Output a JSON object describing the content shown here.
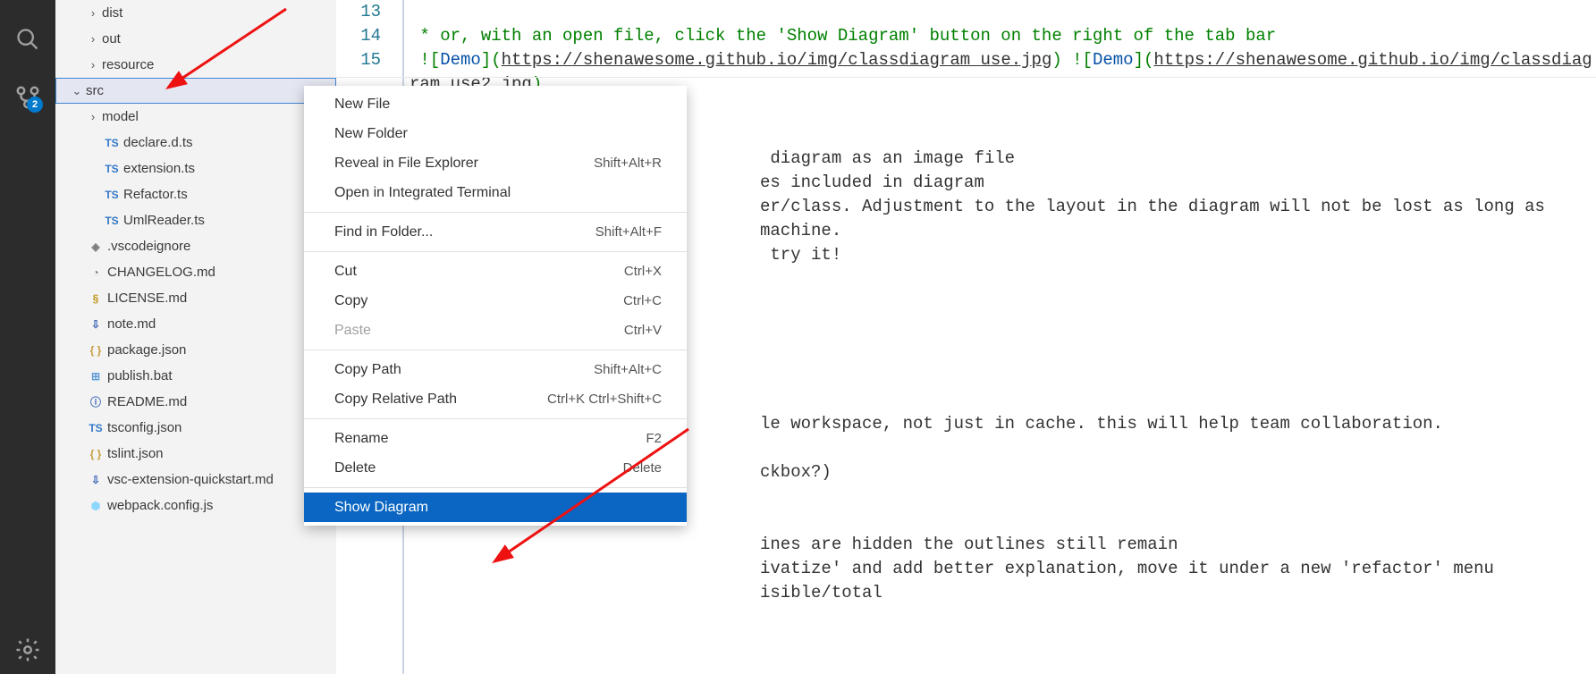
{
  "activity": {
    "search": "search-icon",
    "scm": "source-control-icon",
    "scm_badge": "2",
    "gear": "settings-gear-icon"
  },
  "sidebar": {
    "items": [
      {
        "kind": "folder",
        "open": false,
        "indent": 1,
        "label": "dist"
      },
      {
        "kind": "folder",
        "open": false,
        "indent": 1,
        "label": "out"
      },
      {
        "kind": "folder",
        "open": false,
        "indent": 1,
        "label": "resource"
      },
      {
        "kind": "folder",
        "open": true,
        "indent": 0,
        "label": "src",
        "selected": true
      },
      {
        "kind": "folder",
        "open": false,
        "indent": 1,
        "label": "model"
      },
      {
        "kind": "file",
        "icon": "TS",
        "iconColor": "#3178c6",
        "indent": 2,
        "label": "declare.d.ts"
      },
      {
        "kind": "file",
        "icon": "TS",
        "iconColor": "#3178c6",
        "indent": 2,
        "label": "extension.ts"
      },
      {
        "kind": "file",
        "icon": "TS",
        "iconColor": "#3178c6",
        "indent": 2,
        "label": "Refactor.ts"
      },
      {
        "kind": "file",
        "icon": "TS",
        "iconColor": "#3178c6",
        "indent": 2,
        "label": "UmlReader.ts"
      },
      {
        "kind": "file",
        "icon": "◈",
        "iconColor": "#7a7a7a",
        "indent": 1,
        "label": ".vscodeignore"
      },
      {
        "kind": "file",
        "icon": "◔",
        "iconColor": "#7a7a7a",
        "indent": 1,
        "label": "CHANGELOG.md"
      },
      {
        "kind": "file",
        "icon": "§",
        "iconColor": "#c09820",
        "indent": 1,
        "label": "LICENSE.md"
      },
      {
        "kind": "file",
        "icon": "⇩",
        "iconColor": "#3a66b5",
        "indent": 1,
        "label": "note.md"
      },
      {
        "kind": "file",
        "icon": "{ }",
        "iconColor": "#c79d3c",
        "indent": 1,
        "label": "package.json"
      },
      {
        "kind": "file",
        "icon": "⊞",
        "iconColor": "#5b9bd5",
        "indent": 1,
        "label": "publish.bat"
      },
      {
        "kind": "file",
        "icon": "ⓘ",
        "iconColor": "#3a66b5",
        "indent": 1,
        "label": "README.md"
      },
      {
        "kind": "file",
        "icon": "TS",
        "iconColor": "#3178c6",
        "indent": 1,
        "label": "tsconfig.json"
      },
      {
        "kind": "file",
        "icon": "{ }",
        "iconColor": "#c79d3c",
        "indent": 1,
        "label": "tslint.json"
      },
      {
        "kind": "file",
        "icon": "⇩",
        "iconColor": "#3a66b5",
        "indent": 1,
        "label": "vsc-extension-quickstart.md"
      },
      {
        "kind": "file",
        "icon": "⬢",
        "iconColor": "#8ed6fb",
        "indent": 1,
        "label": "webpack.config.js"
      }
    ]
  },
  "editor": {
    "line_numbers": [
      "13",
      "14",
      "15"
    ],
    "line14_prefix": " * or, with an open file, click the 'Show Diagram' button on the right of the tab bar",
    "line15_a": " ![",
    "line15_demo1": "Demo",
    "line15_b": "](",
    "line15_url1": "https://shenawesome.github.io/img/classdiagram_use.jpg",
    "line15_c": ") ![",
    "line15_demo2": "Demo",
    "line15_d": "](",
    "line15_url2": "https://shenawesome.github.io/img/classdiagram_use2.jpg",
    "line15_e": ")",
    "body_lines": [
      " diagram as an image file",
      "es included in diagram",
      "er/class. Adjustment to the layout in the diagram will not be lost as long as",
      "machine.",
      " try it!",
      "",
      "",
      "",
      "",
      "",
      "",
      "le workspace, not just in cache. this will help team collaboration.",
      "",
      "ckbox?)",
      "",
      "",
      "ines are hidden the outlines still remain",
      "ivatize' and add better explanation, move it under a new 'refactor' menu",
      "isible/total"
    ]
  },
  "context_menu": {
    "groups": [
      [
        {
          "label": "New File",
          "shortcut": ""
        },
        {
          "label": "New Folder",
          "shortcut": ""
        },
        {
          "label": "Reveal in File Explorer",
          "shortcut": "Shift+Alt+R"
        },
        {
          "label": "Open in Integrated Terminal",
          "shortcut": ""
        }
      ],
      [
        {
          "label": "Find in Folder...",
          "shortcut": "Shift+Alt+F"
        }
      ],
      [
        {
          "label": "Cut",
          "shortcut": "Ctrl+X"
        },
        {
          "label": "Copy",
          "shortcut": "Ctrl+C"
        },
        {
          "label": "Paste",
          "shortcut": "Ctrl+V",
          "disabled": true
        }
      ],
      [
        {
          "label": "Copy Path",
          "shortcut": "Shift+Alt+C"
        },
        {
          "label": "Copy Relative Path",
          "shortcut": "Ctrl+K Ctrl+Shift+C"
        }
      ],
      [
        {
          "label": "Rename",
          "shortcut": "F2"
        },
        {
          "label": "Delete",
          "shortcut": "Delete"
        }
      ],
      [
        {
          "label": "Show Diagram",
          "shortcut": "",
          "highlight": true
        }
      ]
    ]
  }
}
